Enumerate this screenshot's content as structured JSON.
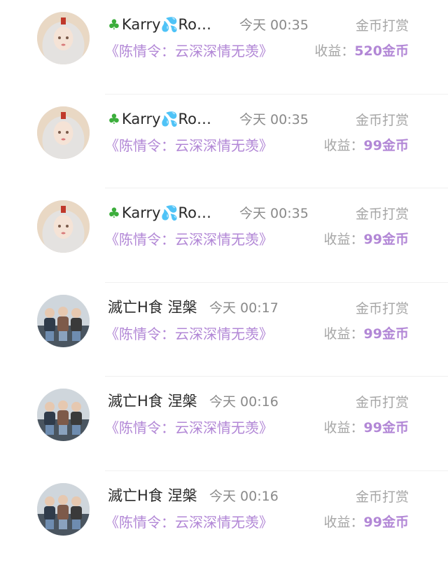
{
  "colors": {
    "purple": "#b287d6",
    "gray": "#a6a6a6",
    "dark": "#2a2a2a"
  },
  "rows": [
    {
      "avatar": "girl-white-hair-avatar",
      "name_prefix_icon": "clover-icon",
      "name_a": "Karry",
      "name_mid_icon": "droplets-icon",
      "name_b": "Ro…",
      "time": "今天 00:35",
      "reward_type": "金币打赏",
      "work": "《陈情令：云深深情无羡》",
      "income_label": "收益：",
      "income_amount": "520金币"
    },
    {
      "avatar": "girl-white-hair-avatar",
      "name_prefix_icon": "clover-icon",
      "name_a": "Karry",
      "name_mid_icon": "droplets-icon",
      "name_b": "Ro…",
      "time": "今天 00:35",
      "reward_type": "金币打赏",
      "work": "《陈情令：云深深情无羡》",
      "income_label": "收益：",
      "income_amount": "99金币"
    },
    {
      "avatar": "girl-white-hair-avatar",
      "name_prefix_icon": "clover-icon",
      "name_a": "Karry",
      "name_mid_icon": "droplets-icon",
      "name_b": "Ro…",
      "time": "今天 00:35",
      "reward_type": "金币打赏",
      "work": "《陈情令：云深深情无羡》",
      "income_label": "收益：",
      "income_amount": "99金币"
    },
    {
      "avatar": "three-boys-avatar",
      "name_a": "滅亡H食 涅槃",
      "time": "今天 00:17",
      "reward_type": "金币打赏",
      "work": "《陈情令：云深深情无羡》",
      "income_label": "收益：",
      "income_amount": "99金币"
    },
    {
      "avatar": "three-boys-avatar",
      "name_a": "滅亡H食 涅槃",
      "time": "今天 00:16",
      "reward_type": "金币打赏",
      "work": "《陈情令：云深深情无羡》",
      "income_label": "收益：",
      "income_amount": "99金币"
    },
    {
      "avatar": "three-boys-avatar",
      "name_a": "滅亡H食 涅槃",
      "time": "今天 00:16",
      "reward_type": "金币打赏",
      "work": "《陈情令：云深深情无羡》",
      "income_label": "收益：",
      "income_amount": "99金币"
    }
  ]
}
